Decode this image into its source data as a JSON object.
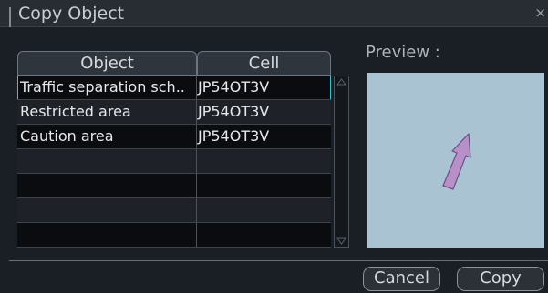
{
  "dialog": {
    "title": "Copy Object",
    "close_glyph": "×"
  },
  "table": {
    "columns": [
      "Object",
      "Cell"
    ],
    "rows": [
      {
        "object": "Traffic separation sch..",
        "cell": "JP54OT3V",
        "selected": true
      },
      {
        "object": "Restricted area",
        "cell": "JP54OT3V",
        "selected": false
      },
      {
        "object": "Caution area",
        "cell": "JP54OT3V",
        "selected": false
      },
      {
        "object": "",
        "cell": ""
      },
      {
        "object": "",
        "cell": ""
      },
      {
        "object": "",
        "cell": ""
      },
      {
        "object": "",
        "cell": ""
      }
    ]
  },
  "preview": {
    "label": "Preview :",
    "background": "#a9c3d3",
    "arrow_fill": "#b890c8",
    "arrow_stroke": "#6b4e86"
  },
  "buttons": {
    "cancel": "Cancel",
    "copy": "Copy"
  },
  "colors": {
    "selection_outline": "#3fc2c9"
  }
}
